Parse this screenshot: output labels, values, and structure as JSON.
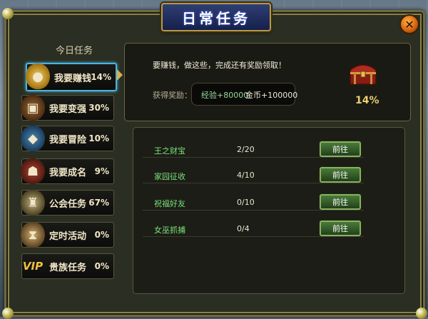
{
  "window": {
    "title": "日常任务"
  },
  "sidebar": {
    "heading": "今日任务",
    "tabs": [
      {
        "label": "我要赚钱",
        "percent": "14%",
        "icon": "gold-coins-icon",
        "active": true
      },
      {
        "label": "我要变强",
        "percent": "30%",
        "icon": "treasure-chest-icon",
        "active": false
      },
      {
        "label": "我要冒险",
        "percent": "10%",
        "icon": "shield-emblem-icon",
        "active": false
      },
      {
        "label": "我要成名",
        "percent": "9%",
        "icon": "warrior-head-icon",
        "active": false
      },
      {
        "label": "公会任务",
        "percent": "67%",
        "icon": "guild-crest-icon",
        "active": false
      },
      {
        "label": "定时活动",
        "percent": "0%",
        "icon": "hourglass-icon",
        "active": false
      },
      {
        "label": "贵族任务",
        "percent": "0%",
        "icon": "vip-icon",
        "active": false,
        "badge": "VIP"
      }
    ]
  },
  "summary": {
    "description": "要赚钱，做这些，完成还有奖励领取！",
    "reward_label": "获得奖励：",
    "reward_exp": "经验+80000",
    "reward_gold": "金币+100000",
    "chest_percent": "14%"
  },
  "tasks": [
    {
      "name": "王之财宝",
      "progress": "2/20",
      "button": "前往"
    },
    {
      "name": "家园征收",
      "progress": "4/10",
      "button": "前往"
    },
    {
      "name": "祝福好友",
      "progress": "0/10",
      "button": "前往"
    },
    {
      "name": "女巫抓捕",
      "progress": "0/4",
      "button": "前往"
    }
  ],
  "colors": {
    "accent": "#4ab4e0",
    "task_name": "#7ae07a",
    "title": "#2f3f74",
    "border": "#6e6a3e"
  }
}
